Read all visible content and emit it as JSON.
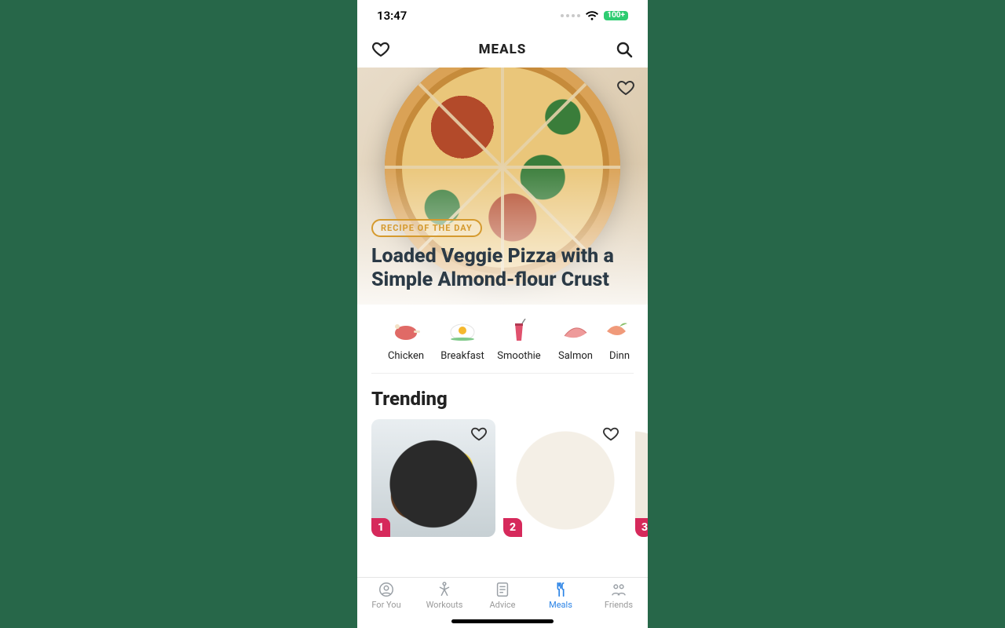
{
  "status": {
    "time": "13:47",
    "battery": "100+"
  },
  "header": {
    "title": "MEALS"
  },
  "hero": {
    "badge": "RECIPE OF THE DAY",
    "title": "Loaded Veggie Pizza with a Simple Almond-flour Crust"
  },
  "categories": [
    {
      "label": "Chicken"
    },
    {
      "label": "Breakfast"
    },
    {
      "label": "Smoothie"
    },
    {
      "label": "Salmon"
    },
    {
      "label": "Dinn"
    }
  ],
  "trending": {
    "heading": "Trending",
    "items": [
      {
        "rank": "1"
      },
      {
        "rank": "2"
      },
      {
        "rank": "3"
      }
    ]
  },
  "tabs": [
    {
      "label": "For You"
    },
    {
      "label": "Workouts"
    },
    {
      "label": "Advice"
    },
    {
      "label": "Meals"
    },
    {
      "label": "Friends"
    }
  ],
  "active_tab_index": 3
}
